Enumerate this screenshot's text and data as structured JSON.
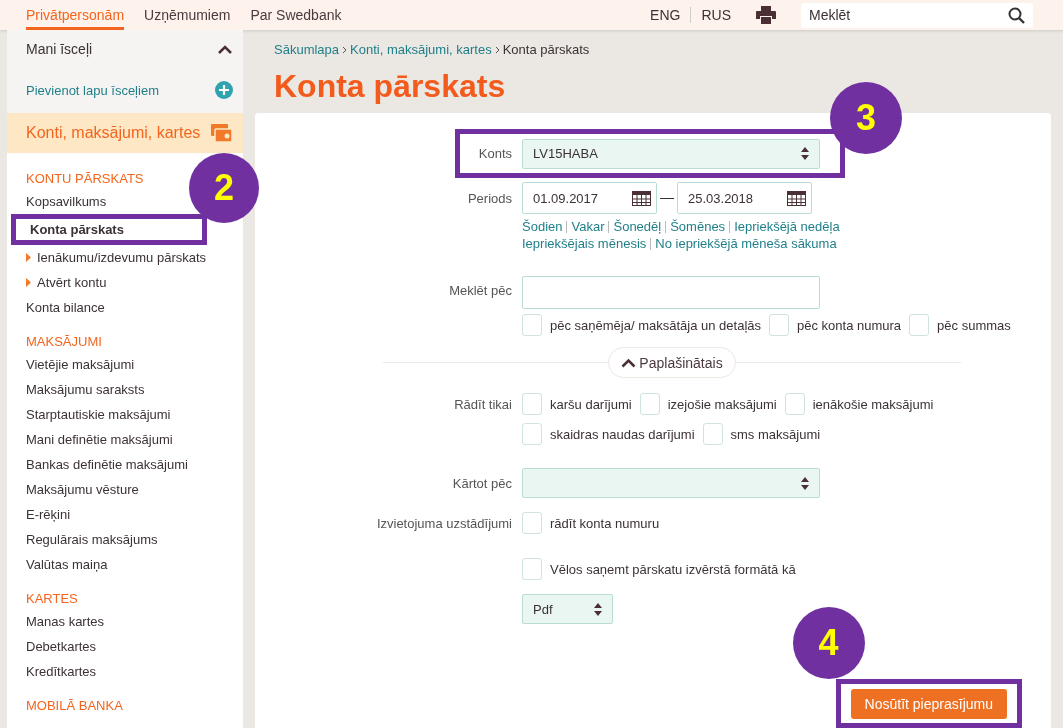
{
  "top_nav": {
    "tabs": [
      {
        "label": "Privātpersonām",
        "selected": true
      },
      {
        "label": "Uzņēmumiem",
        "selected": false
      },
      {
        "label": "Par Swedbank",
        "selected": false
      }
    ],
    "languages": [
      "ENG",
      "RUS"
    ],
    "search": {
      "placeholder": "Meklēt"
    }
  },
  "sidebar": {
    "favorites": {
      "title": "Mani īsceļi",
      "expanded": true,
      "add_label": "Pievienot lapu īsceļiem"
    },
    "active_section": "Konti, maksājumi, kartes",
    "groups": [
      {
        "heading": "KONTU PĀRSKATS",
        "items": [
          {
            "label": "Kopsavilkums",
            "kind": "link",
            "selected": false
          },
          {
            "label": "Konta pārskats",
            "kind": "link",
            "selected": true,
            "callout": "2"
          },
          {
            "label": "Ienākumu/izdevumu pārskats",
            "kind": "sub",
            "selected": false
          },
          {
            "label": "Atvērt kontu",
            "kind": "sub",
            "selected": false
          },
          {
            "label": "Konta bilance",
            "kind": "link",
            "selected": false
          }
        ]
      },
      {
        "heading": "MAKSĀJUMI",
        "items": [
          {
            "label": "Vietējie maksājumi",
            "kind": "link",
            "selected": false
          },
          {
            "label": "Maksājumu saraksts",
            "kind": "link",
            "selected": false
          },
          {
            "label": "Starptautiskie maksājumi",
            "kind": "link",
            "selected": false
          },
          {
            "label": "Mani definētie maksājumi",
            "kind": "link",
            "selected": false
          },
          {
            "label": "Bankas definētie maksājumi",
            "kind": "link",
            "selected": false
          },
          {
            "label": "Maksājumu vēsture",
            "kind": "link",
            "selected": false
          },
          {
            "label": "E-rēķini",
            "kind": "link",
            "selected": false
          },
          {
            "label": "Regulārais maksājums",
            "kind": "link",
            "selected": false
          },
          {
            "label": "Valūtas maiņa",
            "kind": "link",
            "selected": false
          }
        ]
      },
      {
        "heading": "KARTES",
        "items": [
          {
            "label": "Manas kartes",
            "kind": "link",
            "selected": false
          },
          {
            "label": "Debetkartes",
            "kind": "link",
            "selected": false
          },
          {
            "label": "Kredītkartes",
            "kind": "link",
            "selected": false
          }
        ]
      },
      {
        "heading": "MOBILĀ BANKA"
      }
    ]
  },
  "breadcrumb": [
    "Sākumlapa",
    "Konti, maksājumi, kartes",
    "Konta pārskats"
  ],
  "title": "Konta pārskats",
  "form": {
    "account": {
      "label": "Konts",
      "value": "LV15HABA",
      "callout": "3"
    },
    "period": {
      "label": "Periods",
      "from": "01.09.2017",
      "to": "25.03.2018"
    },
    "quick_periods": [
      "Šodien",
      "Vakar",
      "Šonedēļ",
      "Šomēnes",
      "Iepriekšējā nedēļa",
      "Iepriekšējais mēnesis",
      "No iepriekšējā mēneša sākuma"
    ],
    "search": {
      "label": "Meklēt pēc"
    },
    "search_options": [
      {
        "label": "pēc saņēmēja/ maksātāja un detaļās",
        "checked": false
      },
      {
        "label": "pēc konta numura",
        "checked": false
      },
      {
        "label": "pēc summas",
        "checked": false
      }
    ],
    "advanced": {
      "label": "Paplašinātais",
      "expanded": true
    },
    "show_only": {
      "label": "Rādīt tikai",
      "options": [
        {
          "label": "karšu darījumi",
          "checked": false
        },
        {
          "label": "izejošie maksājumi",
          "checked": false
        },
        {
          "label": "ienākošie maksājumi",
          "checked": false
        },
        {
          "label": "skaidras naudas darījumi",
          "checked": false
        },
        {
          "label": "sms maksājumi",
          "checked": false
        }
      ]
    },
    "sort": {
      "label": "Kārtot pēc"
    },
    "layout": {
      "label": "Izvietojuma uzstādījumi",
      "options": [
        {
          "label": "rādīt konta numuru",
          "checked": false
        }
      ]
    },
    "detailed": {
      "label": "Vēlos saņemt pārskatu izvērstā formātā kā",
      "checked": false
    },
    "format": "Pdf",
    "submit": {
      "label": "Nosūtīt pieprasījumu",
      "callout": "4"
    }
  }
}
